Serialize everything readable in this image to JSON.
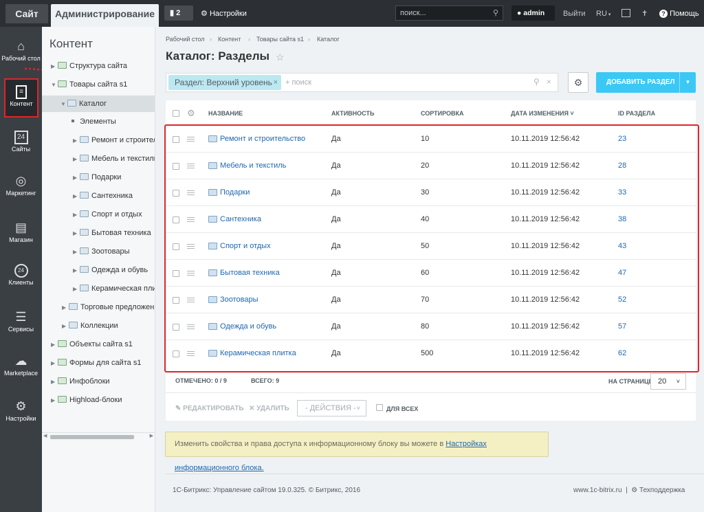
{
  "topbar": {
    "tab_site": "Сайт",
    "tab_admin": "Администрирование",
    "notifications_count": "2",
    "settings_label": "Настройки",
    "search_placeholder": "поиск...",
    "user": "admin",
    "logout": "Выйти",
    "lang": "RU",
    "help": "Помощь"
  },
  "leftnav": [
    {
      "label": "Рабочий стол",
      "icon": "home-icon"
    },
    {
      "label": "Контент",
      "icon": "document-icon"
    },
    {
      "label": "Сайты",
      "icon": "calendar-icon"
    },
    {
      "label": "Маркетинг",
      "icon": "target-icon"
    },
    {
      "label": "Магазин",
      "icon": "basket-icon"
    },
    {
      "label": "Клиенты",
      "icon": "clients-24-icon"
    },
    {
      "label": "Сервисы",
      "icon": "layers-icon"
    },
    {
      "label": "Marketplace",
      "icon": "cloud-download-icon"
    },
    {
      "label": "Настройки",
      "icon": "gear-icon"
    }
  ],
  "tree": {
    "title": "Контент",
    "items": [
      {
        "label": "Структура сайта"
      },
      {
        "label": "Товары сайта s1"
      },
      {
        "label": "Каталог"
      },
      {
        "label": "Элементы"
      },
      {
        "label": "Ремонт и строительство"
      },
      {
        "label": "Мебель и текстиль"
      },
      {
        "label": "Подарки"
      },
      {
        "label": "Сантехника"
      },
      {
        "label": "Спорт и отдых"
      },
      {
        "label": "Бытовая техника"
      },
      {
        "label": "Зоотовары"
      },
      {
        "label": "Одежда и обувь"
      },
      {
        "label": "Керамическая плитка"
      },
      {
        "label": "Торговые предложения"
      },
      {
        "label": "Коллекции"
      },
      {
        "label": "Объекты сайта s1"
      },
      {
        "label": "Формы для сайта s1"
      },
      {
        "label": "Инфоблоки"
      },
      {
        "label": "Highload-блоки"
      }
    ]
  },
  "breadcrumb": [
    "Рабочий стол",
    "Контент",
    "Товары сайта s1",
    "Каталог"
  ],
  "page_title": "Каталог: Разделы",
  "filter": {
    "tag": "Раздел: Верхний уровень",
    "placeholder": "+ поиск"
  },
  "add_button": "ДОБАВИТЬ РАЗДЕЛ",
  "columns": [
    "НАЗВАНИЕ",
    "АКТИВНОСТЬ",
    "СОРТИРОВКА",
    "ДАТА ИЗМЕНЕНИЯ",
    "ID РАЗДЕЛА"
  ],
  "rows": [
    {
      "name": "Ремонт и строительство",
      "active": "Да",
      "sort": "10",
      "date": "10.11.2019 12:56:42",
      "id": "23"
    },
    {
      "name": "Мебель и текстиль",
      "active": "Да",
      "sort": "20",
      "date": "10.11.2019 12:56:42",
      "id": "28"
    },
    {
      "name": "Подарки",
      "active": "Да",
      "sort": "30",
      "date": "10.11.2019 12:56:42",
      "id": "33"
    },
    {
      "name": "Сантехника",
      "active": "Да",
      "sort": "40",
      "date": "10.11.2019 12:56:42",
      "id": "38"
    },
    {
      "name": "Спорт и отдых",
      "active": "Да",
      "sort": "50",
      "date": "10.11.2019 12:56:42",
      "id": "43"
    },
    {
      "name": "Бытовая техника",
      "active": "Да",
      "sort": "60",
      "date": "10.11.2019 12:56:42",
      "id": "47"
    },
    {
      "name": "Зоотовары",
      "active": "Да",
      "sort": "70",
      "date": "10.11.2019 12:56:42",
      "id": "52"
    },
    {
      "name": "Одежда и обувь",
      "active": "Да",
      "sort": "80",
      "date": "10.11.2019 12:56:42",
      "id": "57"
    },
    {
      "name": "Керамическая плитка",
      "active": "Да",
      "sort": "500",
      "date": "10.11.2019 12:56:42",
      "id": "62"
    }
  ],
  "grid_footer": {
    "selected_label": "ОТМЕЧЕНО:",
    "selected_value": "0 / 9",
    "total_label": "ВСЕГО:",
    "total_value": "9",
    "per_page_label": "НА СТРАНИЦЕ:",
    "per_page_value": "20"
  },
  "actions": {
    "edit": "РЕДАКТИРОВАТЬ",
    "delete": "УДАЛИТЬ",
    "select": "- ДЕЙСТВИЯ -",
    "for_all": "ДЛЯ ВСЕХ"
  },
  "note": {
    "text": "Изменить свойства и права доступа к информационному блоку вы можете в ",
    "link": "Настройках информационного блока."
  },
  "footer": {
    "copyright": "1С-Битрикс: Управление сайтом 19.0.325. © Битрикс, 2016",
    "site": "www.1c-bitrix.ru",
    "support": "Техподдержка"
  },
  "colors": {
    "accent": "#3bc8f5",
    "highlight": "#e0252a",
    "topbar": "#2c3034",
    "leftnav": "#3a3f44",
    "note_bg": "#f5f0c4"
  }
}
